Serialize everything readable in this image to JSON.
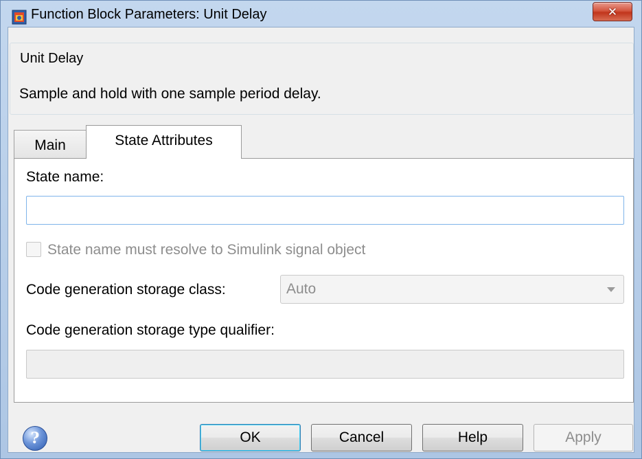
{
  "window": {
    "title": "Function Block Parameters: Unit Delay",
    "close_symbol": "✕"
  },
  "block": {
    "name": "Unit Delay",
    "description": "Sample and hold with one sample period delay."
  },
  "tabs": [
    {
      "label": "Main",
      "active": false
    },
    {
      "label": "State Attributes",
      "active": true
    }
  ],
  "state_attributes": {
    "state_name_label": "State name:",
    "state_name_value": "",
    "resolve_checkbox_label": "State name must resolve to Simulink signal object",
    "resolve_checked": false,
    "storage_class_label": "Code generation storage class:",
    "storage_class_value": "Auto",
    "type_qualifier_label": "Code generation storage type qualifier:",
    "type_qualifier_value": ""
  },
  "footer": {
    "help_icon": "question-icon",
    "ok_label": "OK",
    "cancel_label": "Cancel",
    "help_label": "Help",
    "apply_label": "Apply"
  }
}
